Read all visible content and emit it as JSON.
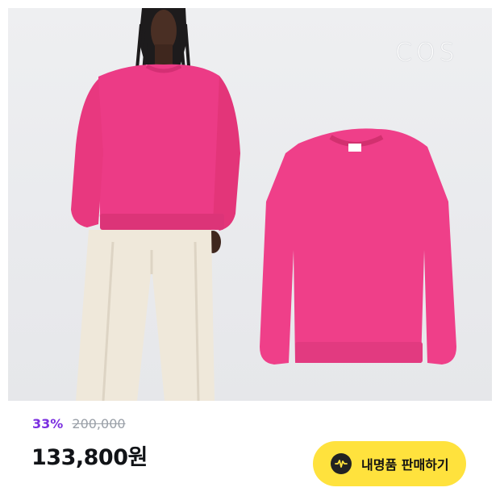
{
  "product": {
    "brand_logo": "COS",
    "discount": "33%",
    "original_price": "200,000",
    "price": "133,800원"
  },
  "actions": {
    "sell_button_label": "내명품 판매하기",
    "sell_icon": "wave-circle-icon"
  },
  "colors": {
    "accent_discount": "#7b2fe0",
    "button_bg": "#ffe23d",
    "sweatshirt": "#ee3d88"
  }
}
